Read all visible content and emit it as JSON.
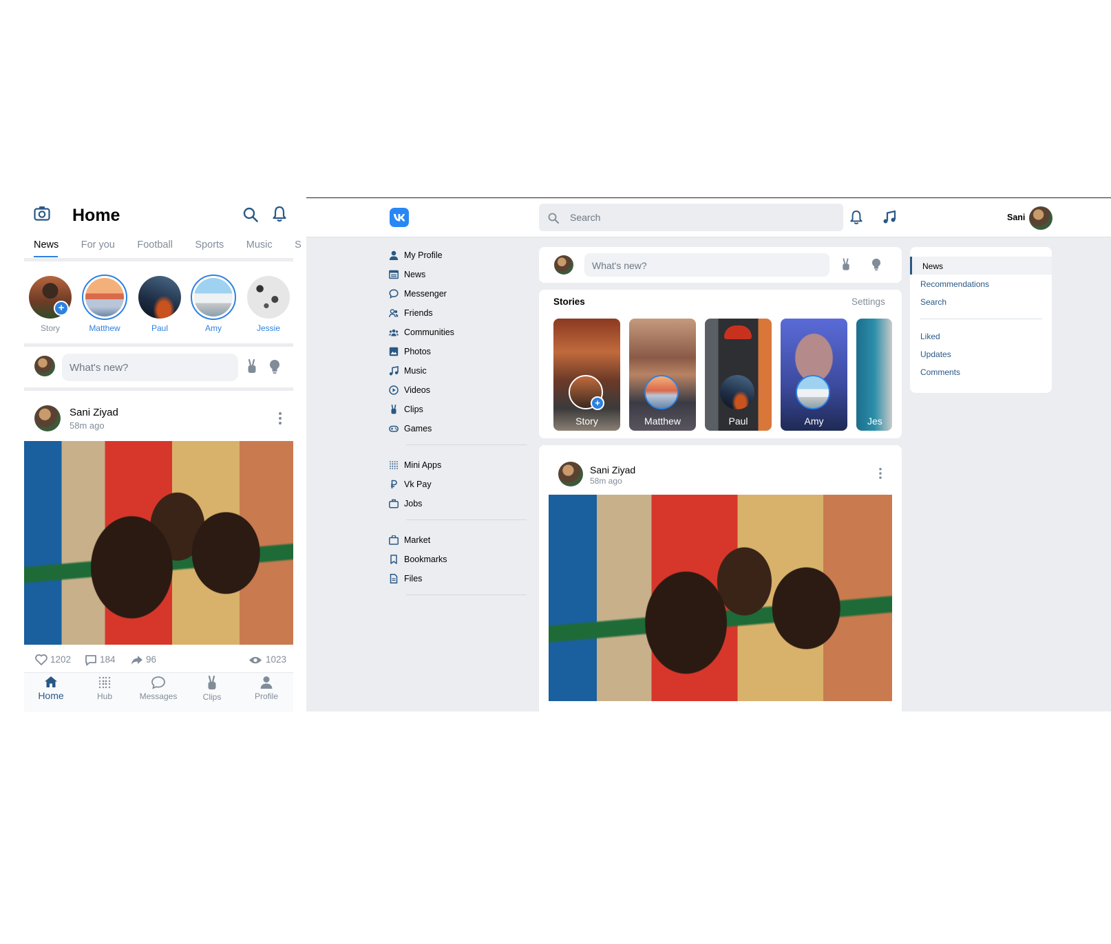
{
  "mobile": {
    "title": "Home",
    "tabs": [
      "News",
      "For you",
      "Football",
      "Sports",
      "Music",
      "S"
    ],
    "stories": [
      {
        "label": "Story",
        "add": true
      },
      {
        "label": "Matthew"
      },
      {
        "label": "Paul"
      },
      {
        "label": "Amy"
      },
      {
        "label": "Jessie"
      }
    ],
    "composer_placeholder": "What's new?",
    "post": {
      "author": "Sani Ziyad",
      "time": "58m ago",
      "likes": "1202",
      "comments": "184",
      "shares": "96",
      "views": "1023"
    },
    "bottom_nav": [
      "Home",
      "Hub",
      "Messages",
      "Clips",
      "Profile"
    ]
  },
  "desktop": {
    "search_placeholder": "Search",
    "user_name": "Sani",
    "left_nav": {
      "group1": [
        "My Profile",
        "News",
        "Messenger",
        "Friends",
        "Communities",
        "Photos",
        "Music",
        "Videos",
        "Clips",
        "Games"
      ],
      "group2": [
        "Mini Apps",
        "Vk Pay",
        "Jobs"
      ],
      "group3": [
        "Market",
        "Bookmarks",
        "Files"
      ]
    },
    "composer_placeholder": "What's new?",
    "stories_title": "Stories",
    "stories_settings": "Settings",
    "stories": [
      "Story",
      "Matthew",
      "Paul",
      "Amy",
      "Jes"
    ],
    "post": {
      "author": "Sani Ziyad",
      "time": "58m ago"
    },
    "right_nav": {
      "group1": [
        "News",
        "Recommendations",
        "Search"
      ],
      "group2": [
        "Liked",
        "Updates",
        "Comments"
      ]
    }
  },
  "colors": {
    "accent": "#2d81e0",
    "link": "#2a5885",
    "bg": "#ebedf0",
    "vk_logo": "#2787f5"
  }
}
